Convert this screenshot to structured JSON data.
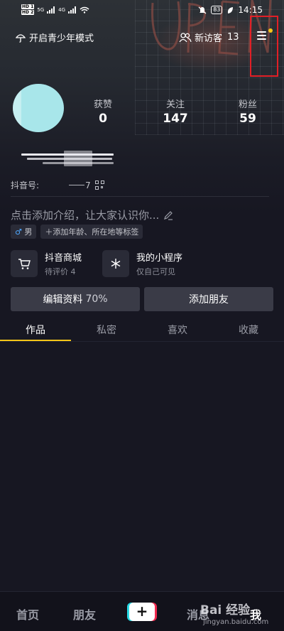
{
  "status_bar": {
    "sim1": "HD 1",
    "sim2": "HD 2",
    "net1": "5G",
    "net2": "4G",
    "battery": "83",
    "time": "14:15"
  },
  "top_bar": {
    "teen_mode_label": "开启青少年模式",
    "visitors_label": "新访客",
    "visitors_count": "13"
  },
  "stats": [
    {
      "label": "获赞",
      "value": "0"
    },
    {
      "label": "关注",
      "value": "147"
    },
    {
      "label": "粉丝",
      "value": "59"
    }
  ],
  "profile": {
    "douyin_id_label": "抖音号:",
    "douyin_id_tail": "7",
    "bio_placeholder": "点击添加介绍，让大家认识你...",
    "gender_tag": "男",
    "add_tags_label": "添加年龄、所在地等标签"
  },
  "apps": [
    {
      "title": "抖音商城",
      "subtitle": "待评价 4"
    },
    {
      "title": "我的小程序",
      "subtitle": "仅自己可见"
    }
  ],
  "actions": {
    "edit_profile": "编辑资料",
    "edit_percent": "70%",
    "add_friend": "添加朋友"
  },
  "tabs": [
    "作品",
    "私密",
    "喜欢",
    "收藏"
  ],
  "bottom_nav": {
    "home": "首页",
    "friends": "朋友",
    "plus": "+",
    "messages": "消息",
    "me": "我"
  },
  "watermark": {
    "main": "Bai 经验",
    "sub": "jingyan.baidu.com"
  },
  "colors": {
    "background": "#171722",
    "accent_yellow": "#f5c518",
    "highlight_box": "#e21f26",
    "button": "#3a3b47"
  }
}
